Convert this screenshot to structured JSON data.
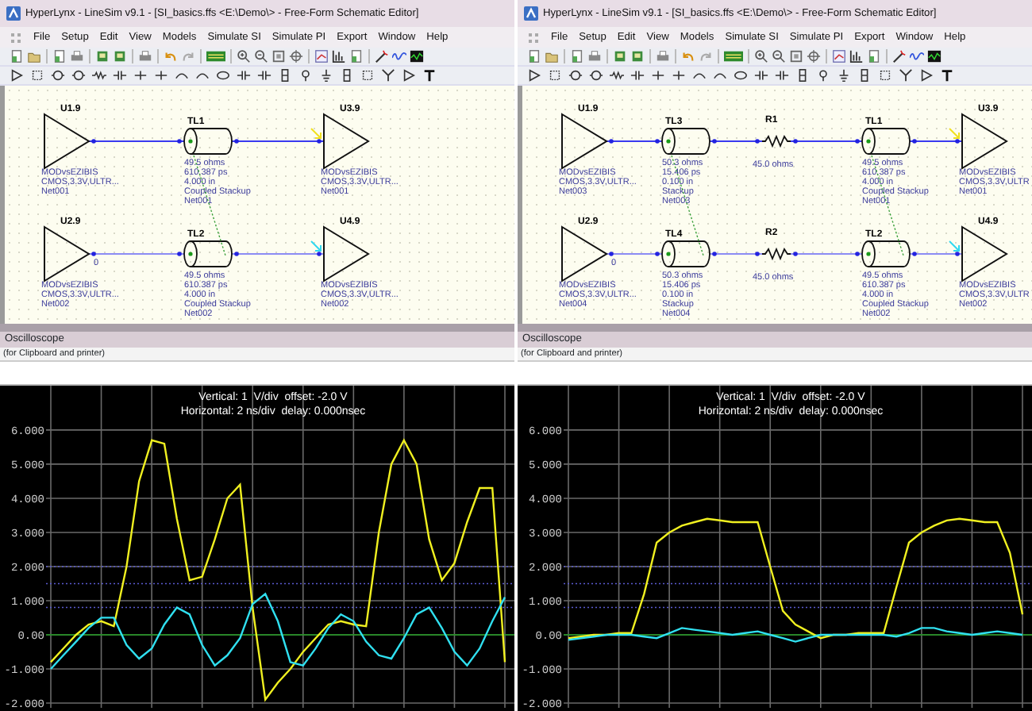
{
  "panels": [
    {
      "window": {
        "title": "HyperLynx - LineSim v9.1 - [SI_basics.ffs <E:\\Demo\\> - Free-Form Schematic Editor]"
      },
      "menu": [
        "File",
        "Setup",
        "Edit",
        "View",
        "Models",
        "Simulate SI",
        "Simulate PI",
        "Export",
        "Window",
        "Help"
      ],
      "schematic": {
        "rows": [
          {
            "items": [
              {
                "kind": "driver",
                "ref": "U1.9",
                "lines": [
                  "MODvsEZIBIS",
                  "CMOS,3.3V,ULTR...",
                  "Net001"
                ]
              },
              {
                "kind": "tline",
                "ref": "TL1",
                "lines": [
                  "49.5 ohms",
                  "610.387 ps",
                  "4.000 in",
                  "Coupled Stackup",
                  "Net001"
                ]
              },
              {
                "kind": "receiver",
                "ref": "U3.9",
                "color": "#f0e020",
                "lines": [
                  "MODvsEZIBIS",
                  "CMOS,3.3V,ULTR...",
                  "Net001"
                ]
              }
            ]
          },
          {
            "items": [
              {
                "kind": "driver",
                "ref": "U2.9",
                "pin": "0",
                "lines": [
                  "MODvsEZIBIS",
                  "CMOS,3.3V,ULTR...",
                  "Net002"
                ]
              },
              {
                "kind": "tline",
                "ref": "TL2",
                "lines": [
                  "49.5 ohms",
                  "610.387 ps",
                  "4.000 in",
                  "Coupled Stackup",
                  "Net002"
                ]
              },
              {
                "kind": "receiver",
                "ref": "U4.9",
                "color": "#30d8f0",
                "lines": [
                  "MODvsEZIBIS",
                  "CMOS,3.3V,ULTR...",
                  "Net002"
                ]
              }
            ]
          }
        ]
      },
      "scope_panel": {
        "title": "Oscilloscope",
        "note": "(for Clipboard and printer)"
      },
      "scope": {
        "header": [
          "Vertical: 1  V/div  offset: -2.0 V",
          "Horizontal: 2 ns/div  delay: 0.000nsec"
        ],
        "chart_data": {
          "type": "line",
          "categories": [
            null,
            null,
            null,
            null,
            null,
            null,
            null,
            null,
            null,
            null,
            null,
            null,
            null,
            null,
            null,
            null,
            null,
            null,
            null,
            null,
            null,
            null,
            null,
            null,
            null,
            null,
            null,
            null,
            null,
            null,
            null,
            null,
            null,
            null,
            null,
            null,
            null
          ],
          "ylim": [
            -2.14,
            7.3
          ],
          "grid": true,
          "yticks": [
            {
              "value": 6,
              "label": "6.000"
            },
            {
              "value": 5,
              "label": "5.000"
            },
            {
              "value": 4,
              "label": "4.000"
            },
            {
              "value": 3,
              "label": "3.000"
            },
            {
              "value": 2,
              "label": "2.000"
            },
            {
              "value": 1,
              "label": "1.000"
            },
            {
              "value": 0,
              "label": "0.00"
            },
            {
              "value": -1,
              "label": "-1.000"
            },
            {
              "value": -2,
              "label": "-2.000"
            }
          ],
          "ref_lines": [
            {
              "axis": "y",
              "value": 0,
              "color": "#1c9a1c"
            },
            {
              "axis": "y",
              "value": 2,
              "color": "#5a5ad0"
            },
            {
              "axis": "y",
              "value": 1.5,
              "color": "#5a5ad0"
            },
            {
              "axis": "y",
              "value": 0.8,
              "color": "#5a5ad0"
            }
          ],
          "series": [
            {
              "color": "#f0f020",
              "values": [
                -0.8,
                -0.4,
                0.0,
                0.3,
                0.4,
                0.25,
                2.0,
                4.5,
                5.7,
                5.6,
                3.4,
                1.6,
                1.7,
                2.8,
                4.0,
                4.4,
                0.8,
                -1.9,
                -1.4,
                -1.0,
                -0.5,
                -0.1,
                0.3,
                0.4,
                0.3,
                0.25,
                3.0,
                5.0,
                5.7,
                5.0,
                2.8,
                1.6,
                2.1,
                3.3,
                4.3,
                4.3,
                -0.8
              ]
            },
            {
              "color": "#30e0f0",
              "values": [
                -1.0,
                -0.6,
                -0.2,
                0.2,
                0.5,
                0.5,
                -0.3,
                -0.7,
                -0.4,
                0.3,
                0.8,
                0.6,
                -0.3,
                -0.9,
                -0.6,
                -0.1,
                0.9,
                1.2,
                0.4,
                -0.8,
                -0.9,
                -0.4,
                0.2,
                0.6,
                0.4,
                -0.2,
                -0.6,
                -0.7,
                -0.1,
                0.6,
                0.8,
                0.2,
                -0.5,
                -0.9,
                -0.4,
                0.4,
                1.1
              ]
            }
          ]
        }
      }
    },
    {
      "window": {
        "title": "HyperLynx - LineSim v9.1 - [SI_basics.ffs <E:\\Demo\\> - Free-Form Schematic Editor]"
      },
      "menu": [
        "File",
        "Setup",
        "Edit",
        "View",
        "Models",
        "Simulate SI",
        "Simulate PI",
        "Export",
        "Window",
        "Help"
      ],
      "schematic": {
        "rows": [
          {
            "items": [
              {
                "kind": "driver",
                "ref": "U1.9",
                "lines": [
                  "MODvsEZIBIS",
                  "CMOS,3.3V,ULTR...",
                  "Net003"
                ]
              },
              {
                "kind": "tline",
                "ref": "TL3",
                "lines": [
                  "50.3 ohms",
                  "15.406 ps",
                  "0.100 in",
                  "Stackup",
                  "Net003"
                ]
              },
              {
                "kind": "resistor",
                "ref": "R1",
                "lines": [
                  "45.0 ohms"
                ]
              },
              {
                "kind": "tline",
                "ref": "TL1",
                "lines": [
                  "49.5 ohms",
                  "610.387 ps",
                  "4.000 in",
                  "Coupled Stackup",
                  "Net001"
                ]
              },
              {
                "kind": "receiver",
                "ref": "U3.9",
                "color": "#f0e020",
                "lines": [
                  "MODvsEZIBIS",
                  "CMOS,3.3V,ULTR",
                  "Net001"
                ]
              }
            ]
          },
          {
            "items": [
              {
                "kind": "driver",
                "ref": "U2.9",
                "pin": "0",
                "lines": [
                  "MODvsEZIBIS",
                  "CMOS,3.3V,ULTR...",
                  "Net004"
                ]
              },
              {
                "kind": "tline",
                "ref": "TL4",
                "lines": [
                  "50.3 ohms",
                  "15.406 ps",
                  "0.100 in",
                  "Stackup",
                  "Net004"
                ]
              },
              {
                "kind": "resistor",
                "ref": "R2",
                "lines": [
                  "45.0 ohms"
                ]
              },
              {
                "kind": "tline",
                "ref": "TL2",
                "lines": [
                  "49.5 ohms",
                  "610.387 ps",
                  "4.000 in",
                  "Coupled Stackup",
                  "Net002"
                ]
              },
              {
                "kind": "receiver",
                "ref": "U4.9",
                "color": "#30d8f0",
                "lines": [
                  "MODvsEZIBIS",
                  "CMOS,3.3V,ULTR",
                  "Net002"
                ]
              }
            ]
          }
        ]
      },
      "scope_panel": {
        "title": "Oscilloscope",
        "note": "(for Clipboard and printer)"
      },
      "scope": {
        "header": [
          "Vertical: 1  V/div  offset: -2.0 V",
          "Horizontal: 2 ns/div  delay: 0.000nsec"
        ],
        "chart_data": {
          "type": "line",
          "categories": [
            null,
            null,
            null,
            null,
            null,
            null,
            null,
            null,
            null,
            null,
            null,
            null,
            null,
            null,
            null,
            null,
            null,
            null,
            null,
            null,
            null,
            null,
            null,
            null,
            null,
            null,
            null,
            null,
            null,
            null,
            null,
            null,
            null,
            null,
            null,
            null,
            null
          ],
          "ylim": [
            -2.14,
            7.3
          ],
          "grid": true,
          "yticks": [
            {
              "value": 6,
              "label": "6.000"
            },
            {
              "value": 5,
              "label": "5.000"
            },
            {
              "value": 4,
              "label": "4.000"
            },
            {
              "value": 3,
              "label": "3.000"
            },
            {
              "value": 2,
              "label": "2.000"
            },
            {
              "value": 1,
              "label": "1.000"
            },
            {
              "value": 0,
              "label": "0.00"
            },
            {
              "value": -1,
              "label": "-1.000"
            },
            {
              "value": -2,
              "label": "-2.000"
            }
          ],
          "ref_lines": [
            {
              "axis": "y",
              "value": 0,
              "color": "#1c9a1c"
            },
            {
              "axis": "y",
              "value": 2,
              "color": "#5a5ad0"
            },
            {
              "axis": "y",
              "value": 1.5,
              "color": "#5a5ad0"
            },
            {
              "axis": "y",
              "value": 0.8,
              "color": "#5a5ad0"
            }
          ],
          "series": [
            {
              "color": "#f0f020",
              "values": [
                -0.1,
                -0.05,
                0.0,
                0.0,
                0.05,
                0.05,
                1.2,
                2.7,
                3.0,
                3.2,
                3.3,
                3.4,
                3.35,
                3.3,
                3.3,
                3.3,
                2.0,
                0.7,
                0.3,
                0.1,
                -0.1,
                0.0,
                0.0,
                0.05,
                0.05,
                0.05,
                1.4,
                2.7,
                3.0,
                3.2,
                3.35,
                3.4,
                3.35,
                3.3,
                3.3,
                2.4,
                0.6
              ]
            },
            {
              "color": "#30e0f0",
              "values": [
                -0.15,
                -0.1,
                -0.05,
                0.0,
                0.0,
                0.0,
                -0.05,
                -0.1,
                0.05,
                0.2,
                0.15,
                0.1,
                0.05,
                0.0,
                0.05,
                0.1,
                0.0,
                -0.1,
                -0.2,
                -0.1,
                0.0,
                0.0,
                0.0,
                0.0,
                0.0,
                0.0,
                -0.05,
                0.05,
                0.2,
                0.2,
                0.1,
                0.05,
                0.0,
                0.05,
                0.1,
                0.05,
                0.0
              ]
            }
          ]
        }
      }
    }
  ]
}
